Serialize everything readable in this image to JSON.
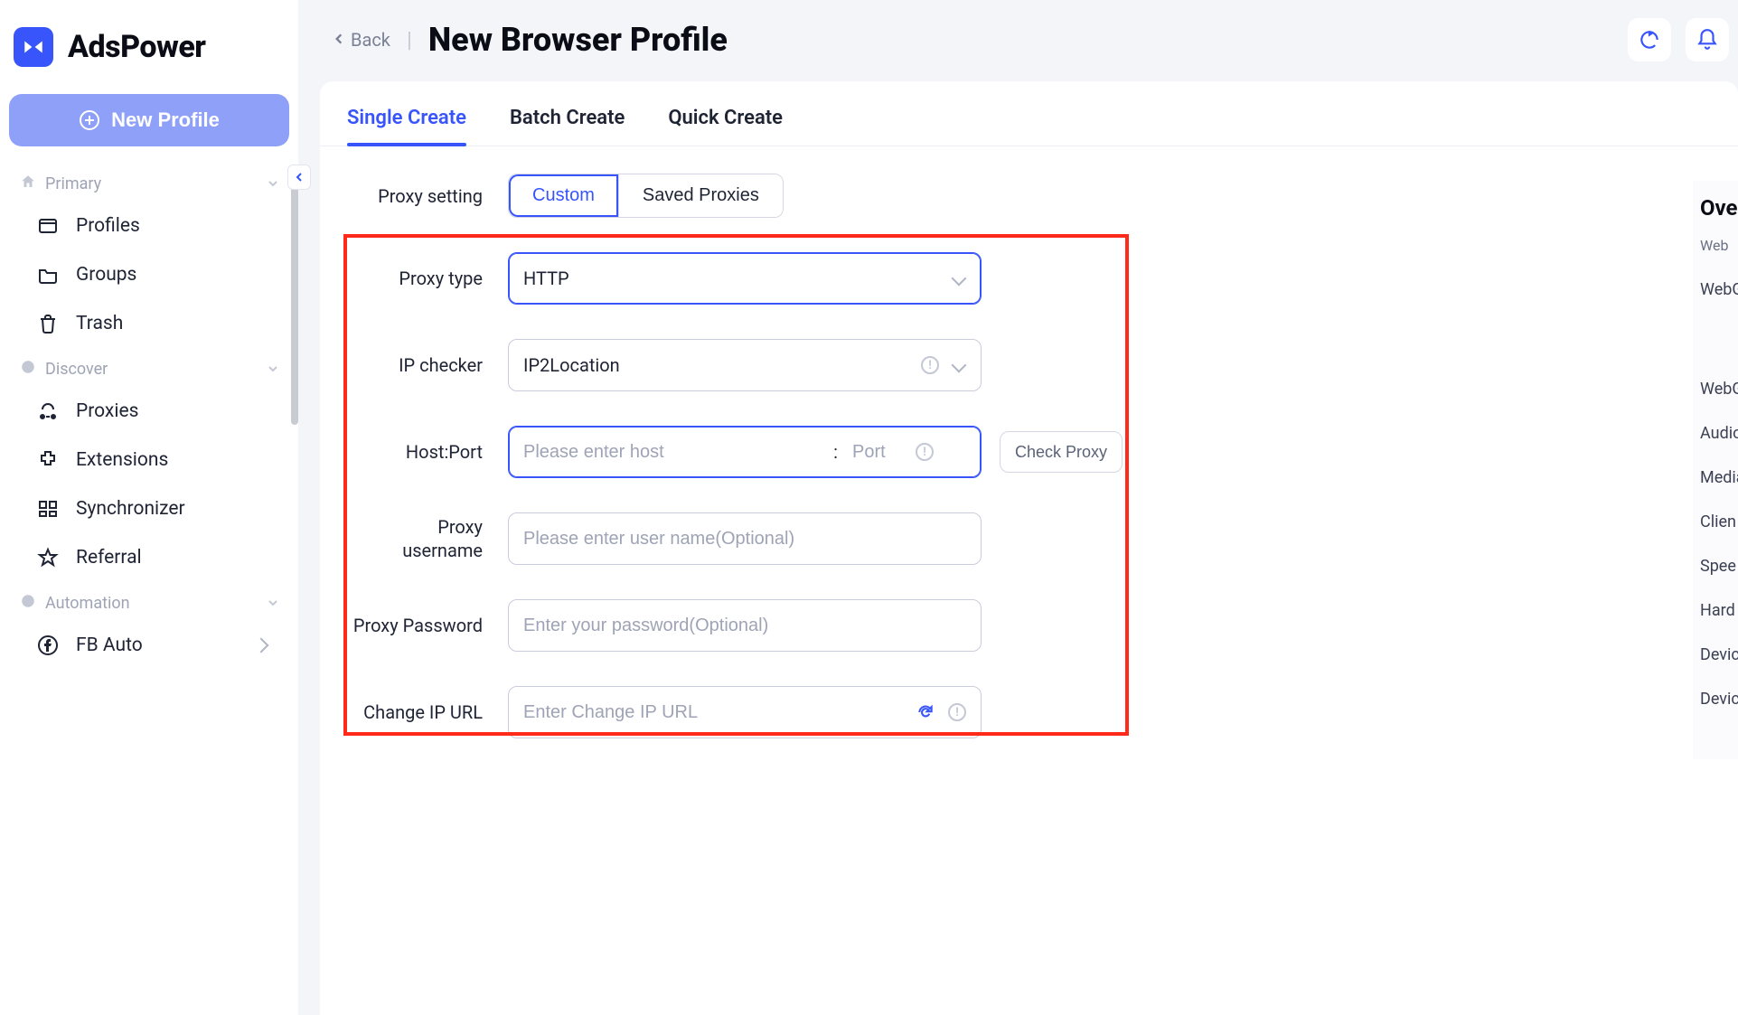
{
  "brand": {
    "name": "AdsPower"
  },
  "sidebar": {
    "new_profile_label": "New Profile",
    "sections": {
      "primary": {
        "label": "Primary"
      },
      "discover": {
        "label": "Discover"
      },
      "automation": {
        "label": "Automation"
      }
    },
    "items": {
      "profiles": "Profiles",
      "groups": "Groups",
      "trash": "Trash",
      "proxies": "Proxies",
      "extensions": "Extensions",
      "synchronizer": "Synchronizer",
      "referral": "Referral",
      "fb_auto": "FB Auto"
    }
  },
  "header": {
    "back_label": "Back",
    "page_title": "New Browser Profile"
  },
  "tabs": {
    "single": "Single Create",
    "batch": "Batch Create",
    "quick": "Quick Create"
  },
  "form": {
    "proxy_setting": {
      "label": "Proxy setting",
      "custom": "Custom",
      "saved": "Saved Proxies"
    },
    "proxy_type": {
      "label": "Proxy type",
      "value": "HTTP"
    },
    "ip_checker": {
      "label": "IP checker",
      "value": "IP2Location"
    },
    "host_port": {
      "label": "Host:Port",
      "host_placeholder": "Please enter host",
      "port_placeholder": "Port",
      "check_btn": "Check Proxy"
    },
    "proxy_username": {
      "label_line1": "Proxy",
      "label_line2": "username",
      "placeholder": "Please enter user name(Optional)"
    },
    "proxy_password": {
      "label": "Proxy Password",
      "placeholder": "Enter your password(Optional)"
    },
    "change_ip_url": {
      "label": "Change IP URL",
      "placeholder": "Enter Change IP URL"
    }
  },
  "overview": {
    "title": "Ove",
    "items": [
      "Web",
      "WebGL meta ta",
      "WebG",
      "Audio",
      "Media device",
      "Clien",
      "Spee",
      "Hard",
      "Devic",
      "Devic"
    ]
  }
}
